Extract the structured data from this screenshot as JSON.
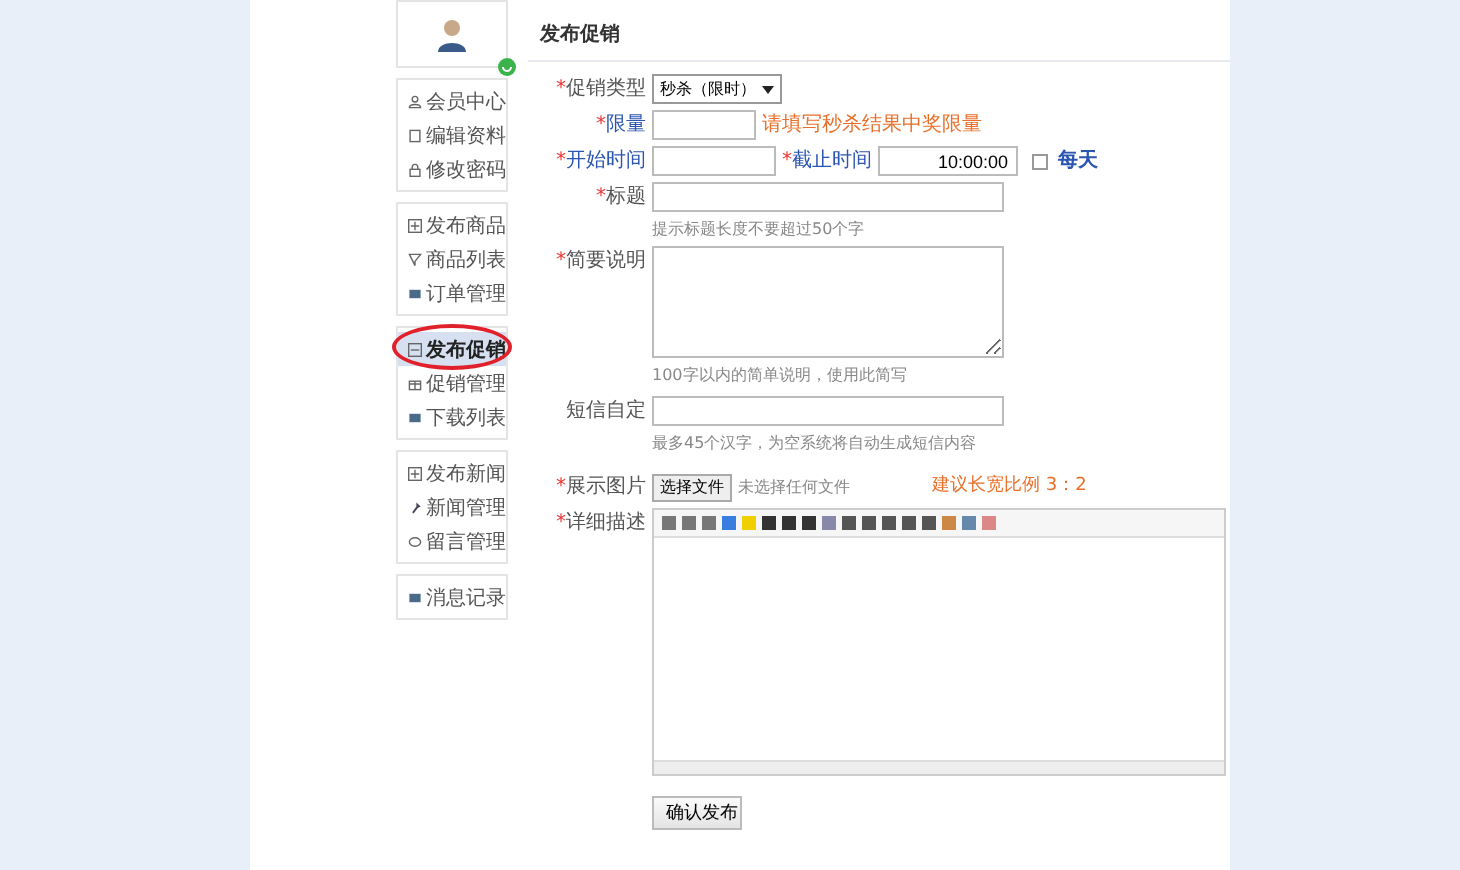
{
  "sidebar": {
    "groups": [
      {
        "items": [
          {
            "label": "会员中心",
            "selected": false
          },
          {
            "label": "编辑资料",
            "selected": false
          },
          {
            "label": "修改密码",
            "selected": false
          }
        ]
      },
      {
        "items": [
          {
            "label": "发布商品",
            "selected": false
          },
          {
            "label": "商品列表",
            "selected": false
          },
          {
            "label": "订单管理",
            "selected": false
          }
        ]
      },
      {
        "items": [
          {
            "label": "发布促销",
            "selected": true
          },
          {
            "label": "促销管理",
            "selected": false
          },
          {
            "label": "下载列表",
            "selected": false
          }
        ]
      },
      {
        "items": [
          {
            "label": "发布新闻",
            "selected": false
          },
          {
            "label": "新闻管理",
            "selected": false
          },
          {
            "label": "留言管理",
            "selected": false
          }
        ]
      },
      {
        "items": [
          {
            "label": "消息记录",
            "selected": false
          }
        ]
      }
    ]
  },
  "page_title": "发布促销",
  "form": {
    "type": {
      "mark": "*",
      "label": "促销类型",
      "value": "秒杀（限时）"
    },
    "limit": {
      "mark": "*",
      "label": "限量",
      "hint": "请填写秒杀结果中奖限量"
    },
    "start": {
      "mark": "*",
      "label": "开始时间"
    },
    "end": {
      "mark": "*",
      "label": "截止时间",
      "value": "10:00:00"
    },
    "daily": {
      "label": "每天",
      "checked": false
    },
    "title": {
      "mark": "*",
      "label": "标题",
      "hint": "提示标题长度不要超过50个字"
    },
    "summary": {
      "mark": "*",
      "label": "简要说明",
      "hint": "100字以内的简单说明，使用此简写"
    },
    "sms": {
      "label": "短信自定",
      "hint": "最多45个汉字，为空系统将自动生成短信内容"
    },
    "image": {
      "mark": "*",
      "label": "展示图片",
      "button": "选择文件",
      "status": "未选择任何文件",
      "tip": "建议长宽比例 3：2"
    },
    "detail": {
      "mark": "*",
      "label": "详细描述"
    }
  },
  "submit": "确认发布"
}
